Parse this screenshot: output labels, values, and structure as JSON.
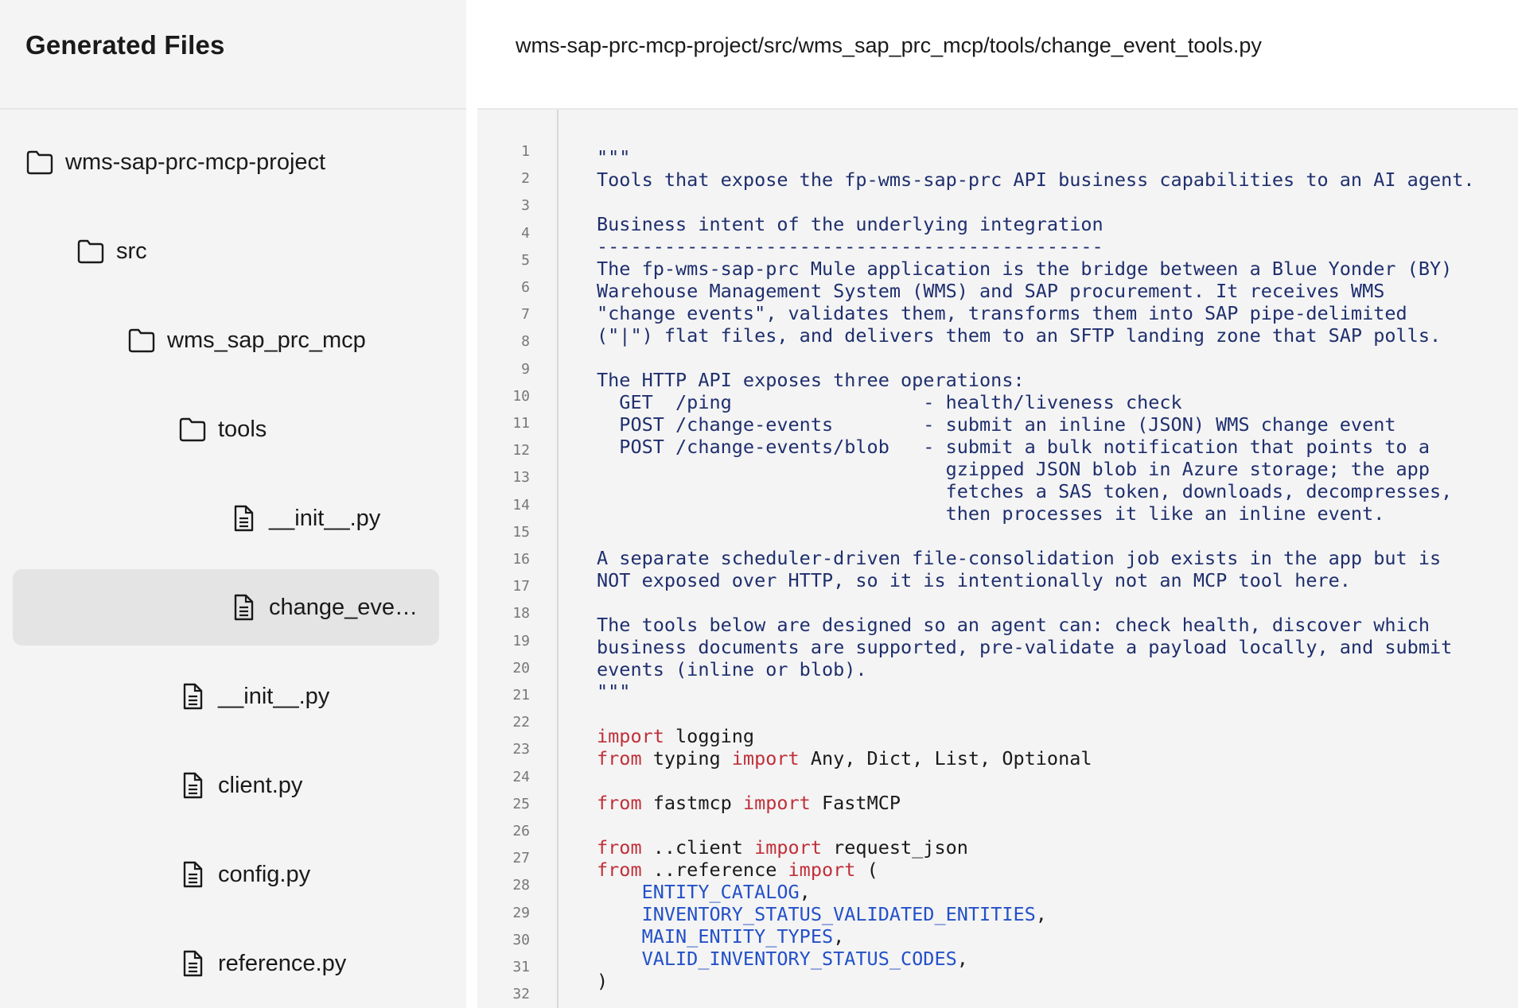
{
  "sidebar": {
    "title": "Generated Files",
    "items": [
      {
        "label": "wms-sap-prc-mcp-project",
        "icon": "folder-icon"
      },
      {
        "label": "src",
        "icon": "folder-icon"
      },
      {
        "label": "wms_sap_prc_mcp",
        "icon": "folder-icon"
      },
      {
        "label": "tools",
        "icon": "folder-icon"
      },
      {
        "label": "__init__.py",
        "icon": "file-icon"
      },
      {
        "label": "change_eve…",
        "icon": "file-icon",
        "selected": true
      },
      {
        "label": "__init__.py",
        "icon": "file-icon"
      },
      {
        "label": "client.py",
        "icon": "file-icon"
      },
      {
        "label": "config.py",
        "icon": "file-icon"
      },
      {
        "label": "reference.py",
        "icon": "file-icon"
      }
    ]
  },
  "editor": {
    "file_path": "wms-sap-prc-mcp-project/src/wms_sap_prc_mcp/tools/change_event_tools.py",
    "lines": [
      [
        [
          "doc",
          "\"\"\""
        ]
      ],
      [
        [
          "doc",
          "Tools that expose the fp-wms-sap-prc API business capabilities to an AI agent."
        ]
      ],
      [],
      [
        [
          "doc",
          "Business intent of the underlying integration"
        ]
      ],
      [
        [
          "doc",
          "---------------------------------------------"
        ]
      ],
      [
        [
          "doc",
          "The fp-wms-sap-prc Mule application is the bridge between a Blue Yonder (BY)"
        ]
      ],
      [
        [
          "doc",
          "Warehouse Management System (WMS) and SAP procurement. It receives WMS"
        ]
      ],
      [
        [
          "doc",
          "\"change events\", validates them, transforms them into SAP pipe-delimited"
        ]
      ],
      [
        [
          "doc",
          "(\"|\") flat files, and delivers them to an SFTP landing zone that SAP polls."
        ]
      ],
      [],
      [
        [
          "doc",
          "The HTTP API exposes three operations:"
        ]
      ],
      [
        [
          "doc",
          "  GET  /ping                 - health/liveness check"
        ]
      ],
      [
        [
          "doc",
          "  POST /change-events        - submit an inline (JSON) WMS change event"
        ]
      ],
      [
        [
          "doc",
          "  POST /change-events/blob   - submit a bulk notification that points to a"
        ]
      ],
      [
        [
          "doc",
          "                               gzipped JSON blob in Azure storage; the app"
        ]
      ],
      [
        [
          "doc",
          "                               fetches a SAS token, downloads, decompresses,"
        ]
      ],
      [
        [
          "doc",
          "                               then processes it like an inline event."
        ]
      ],
      [],
      [
        [
          "doc",
          "A separate scheduler-driven file-consolidation job exists in the app but is"
        ]
      ],
      [
        [
          "doc",
          "NOT exposed over HTTP, so it is intentionally not an MCP tool here."
        ]
      ],
      [],
      [
        [
          "doc",
          "The tools below are designed so an agent can: check health, discover which"
        ]
      ],
      [
        [
          "doc",
          "business documents are supported, pre-validate a payload locally, and submit"
        ]
      ],
      [
        [
          "doc",
          "events (inline or blob)."
        ]
      ],
      [
        [
          "doc",
          "\"\"\""
        ]
      ],
      [],
      [
        [
          "kw",
          "import"
        ],
        [
          "plain",
          " logging"
        ]
      ],
      [
        [
          "kw",
          "from"
        ],
        [
          "plain",
          " typing "
        ],
        [
          "kw",
          "import"
        ],
        [
          "plain",
          " Any, Dict, List, Optional"
        ]
      ],
      [],
      [
        [
          "kw",
          "from"
        ],
        [
          "plain",
          " fastmcp "
        ],
        [
          "kw",
          "import"
        ],
        [
          "plain",
          " FastMCP"
        ]
      ],
      [],
      [
        [
          "kw",
          "from"
        ],
        [
          "plain",
          " ..client "
        ],
        [
          "kw",
          "import"
        ],
        [
          "plain",
          " request_json"
        ]
      ],
      [
        [
          "kw",
          "from"
        ],
        [
          "plain",
          " ..reference "
        ],
        [
          "kw",
          "import"
        ],
        [
          "plain",
          " ("
        ]
      ],
      [
        [
          "plain",
          "    "
        ],
        [
          "name",
          "ENTITY_CATALOG"
        ],
        [
          "plain",
          ","
        ]
      ],
      [
        [
          "plain",
          "    "
        ],
        [
          "name",
          "INVENTORY_STATUS_VALIDATED_ENTITIES"
        ],
        [
          "plain",
          ","
        ]
      ],
      [
        [
          "plain",
          "    "
        ],
        [
          "name",
          "MAIN_ENTITY_TYPES"
        ],
        [
          "plain",
          ","
        ]
      ],
      [
        [
          "plain",
          "    "
        ],
        [
          "name",
          "VALID_INVENTORY_STATUS_CODES"
        ],
        [
          "plain",
          ","
        ]
      ],
      [
        [
          "plain",
          ")"
        ]
      ]
    ],
    "line_numbers": [
      "1",
      "2",
      "3",
      "4",
      "5",
      "6",
      "7",
      "8",
      "9",
      "10",
      "11",
      "12",
      "13",
      "14",
      "15",
      "16",
      "17",
      "18",
      "19",
      "20",
      "21",
      "22",
      "23",
      "24",
      "25",
      "26",
      "27",
      "28",
      "29",
      "30",
      "31",
      "32"
    ]
  }
}
